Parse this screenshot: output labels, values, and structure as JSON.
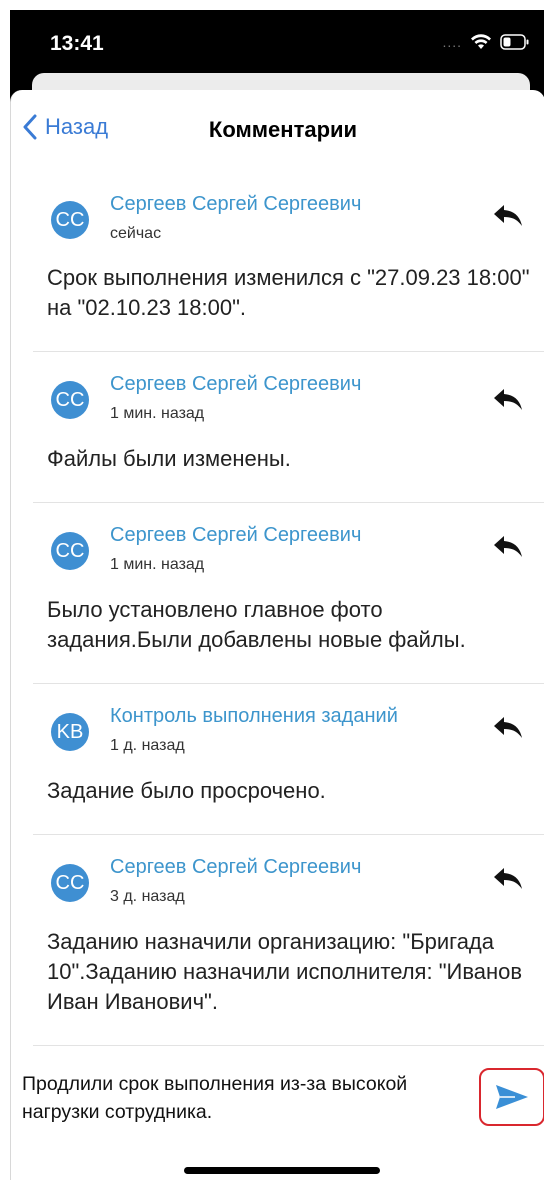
{
  "status_bar": {
    "time": "13:41",
    "signal": "....",
    "icons": [
      "wifi-icon",
      "battery-icon"
    ]
  },
  "nav": {
    "back_label": "Назад",
    "title": "Комментарии"
  },
  "comments": [
    {
      "initials": "CC",
      "author": "Сергеев Сергей Сергеевич",
      "time": "сейчас",
      "text": "Срок выполнения изменился с \"27.09.23 18:00\" на \"02.10.23 18:00\"."
    },
    {
      "initials": "CC",
      "author": "Сергеев Сергей Сергеевич",
      "time": "1 мин. назад",
      "text": "Файлы были изменены."
    },
    {
      "initials": "CC",
      "author": "Сергеев Сергей Сергеевич",
      "time": "1 мин. назад",
      "text": "Было установлено главное фото задания.Были добавлены новые файлы."
    },
    {
      "initials": "KB",
      "author": "Контроль выполнения заданий",
      "time": "1 д. назад",
      "text": "Задание было просрочено."
    },
    {
      "initials": "CC",
      "author": "Сергеев Сергей Сергеевич",
      "time": "3 д. назад",
      "text": "Заданию назначили организацию: \"Бригада 10\".Заданию назначили исполнителя: \"Иванов Иван Иванович\"."
    }
  ],
  "composer": {
    "value": "Продлили срок выполнения из-за высокой нагрузки сотрудника."
  },
  "colors": {
    "accent": "#3a7bd5",
    "author": "#3d95cc",
    "avatar": "#3f8fd2",
    "send_border": "#d9272e"
  }
}
